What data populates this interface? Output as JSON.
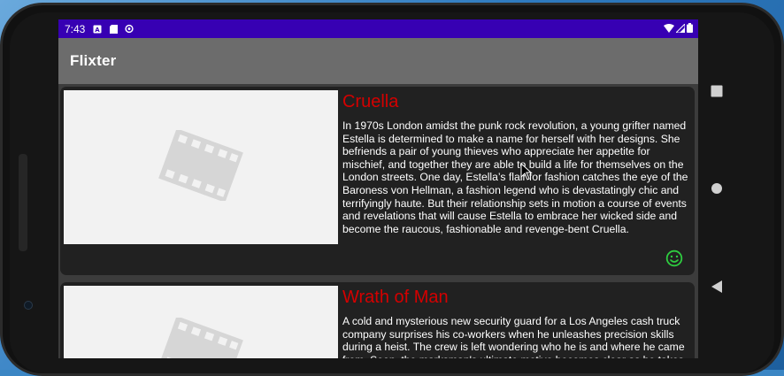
{
  "status_bar": {
    "time": "7:43",
    "icons": [
      "a-notification-icon",
      "sd-card-icon",
      "sync-icon"
    ],
    "right_icons": [
      "wifi-icon",
      "cell-signal-icon",
      "battery-icon"
    ]
  },
  "app_bar": {
    "title": "Flixter"
  },
  "movies": [
    {
      "title": "Cruella",
      "overview": "In 1970s London amidst the punk rock revolution, a young grifter named Estella is determined to make a name for herself with her designs. She befriends a pair of young thieves who appreciate her appetite for mischief, and together they are able to build a life for themselves on the London streets. One day, Estella’s flair for fashion catches the eye of the Baroness von Hellman, a fashion legend who is devastatingly chic and terrifyingly haute. But their relationship sets in motion a course of events and revelations that will cause Estella to embrace her wicked side and become the raucous, fashionable and revenge-bent Cruella.",
      "poster_icon": "film-placeholder-icon",
      "has_smiley": true
    },
    {
      "title": "Wrath of Man",
      "overview": "A cold and mysterious new security guard for a Los Angeles cash truck company surprises his co-workers when he unleashes precision skills during a heist. The crew is left wondering who he is and where he came from. Soon, the marksman's ultimate motive becomes clear as he takes dramatic and irrevocable steps to settle a score.",
      "poster_icon": "film-placeholder-icon",
      "has_smiley": false
    }
  ],
  "colors": {
    "status_bar": "#3700b3",
    "app_bar": "#6c6c6c",
    "card_bg": "#212121",
    "title_red": "#d40000",
    "smiley_green": "#2ecc40"
  },
  "nav_buttons": [
    "recents-button",
    "home-button",
    "back-button"
  ]
}
